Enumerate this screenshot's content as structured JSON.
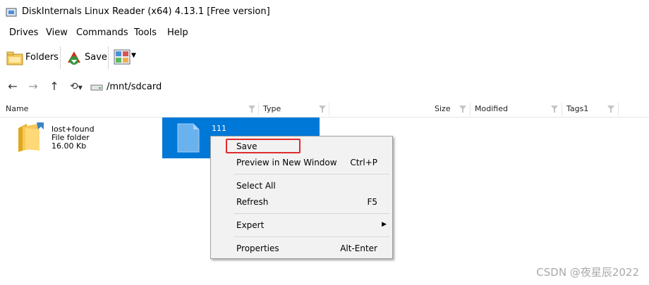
{
  "window": {
    "title": "DiskInternals Linux Reader (x64) 4.13.1 [Free version]"
  },
  "menu": [
    "Drives",
    "View",
    "Commands",
    "Tools",
    "Help"
  ],
  "toolbar": {
    "folders_label": "Folders",
    "save_label": "Save"
  },
  "address": {
    "path": "/mnt/sdcard"
  },
  "columns": {
    "name": "Name",
    "type": "Type",
    "size": "Size",
    "modified": "Modified",
    "tags": "Tags1"
  },
  "items": [
    {
      "name": "lost+found",
      "type": "File folder",
      "size": "16.00 Kb",
      "icon": "folder-icon"
    },
    {
      "name": "111",
      "icon": "file-icon"
    }
  ],
  "context_menu": {
    "save": "Save",
    "preview": "Preview in New Window",
    "preview_shortcut": "Ctrl+P",
    "select_all": "Select All",
    "refresh": "Refresh",
    "refresh_shortcut": "F5",
    "expert": "Expert",
    "properties": "Properties",
    "properties_shortcut": "Alt-Enter"
  },
  "watermark": "CSDN @夜星辰2022",
  "colors": {
    "selection": "#0078d7",
    "highlight_box": "#e02b2b"
  }
}
